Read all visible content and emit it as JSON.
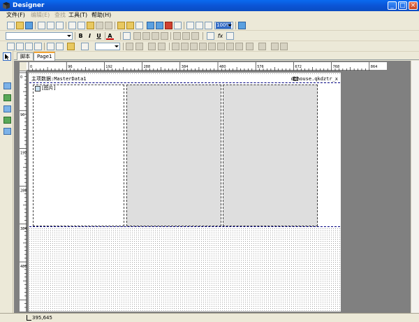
{
  "window": {
    "title": "Designer",
    "controls": [
      "_",
      "□",
      "×"
    ]
  },
  "menu": [
    {
      "label": "文件(F)",
      "enabled": true
    },
    {
      "label": "编辑(E)",
      "enabled": false
    },
    {
      "label": "查找",
      "enabled": false
    },
    {
      "label": "工具(T)",
      "enabled": true
    },
    {
      "label": "帮助(H)",
      "enabled": true
    }
  ],
  "toolbar": {
    "zoom": "100%",
    "bold": "B",
    "italic": "I",
    "underline": "U",
    "font_color": "A",
    "fx": "fx"
  },
  "tabs": [
    {
      "label": "脚本",
      "active": false
    },
    {
      "label": "Page1",
      "active": true
    }
  ],
  "ruler": {
    "h_labels": [
      "0",
      "96",
      "192",
      "288",
      "384",
      "480",
      "576",
      "672",
      "768",
      "864"
    ],
    "v_labels": [
      "0",
      "96",
      "192",
      "288",
      "384",
      "480"
    ]
  },
  "band": {
    "title": "主项数据:MasterData1",
    "source": "dbhouse.qkdztr_x"
  },
  "picture_label": "[图片]",
  "status": {
    "coords": "395,645"
  },
  "colors": {
    "titlebar": "#0B55D6",
    "band_border": "#000080",
    "canvas": "#808080",
    "cell_fill": "#DEDEDE"
  }
}
